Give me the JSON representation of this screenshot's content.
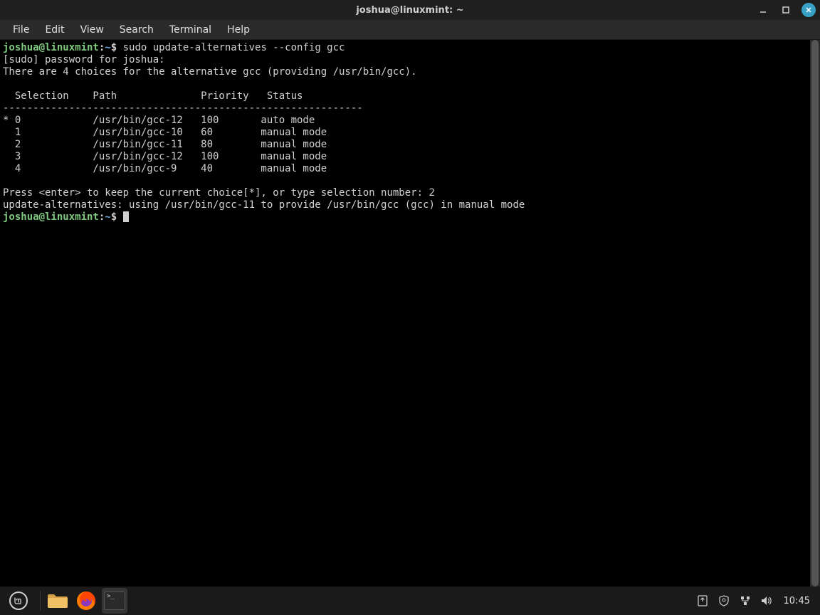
{
  "window": {
    "title": "joshua@linuxmint: ~"
  },
  "menubar": {
    "items": [
      "File",
      "Edit",
      "View",
      "Search",
      "Terminal",
      "Help"
    ]
  },
  "terminal": {
    "prompt_user": "joshua@linuxmint",
    "prompt_path": "~",
    "prompt_symbol": "$",
    "line1_cmd": "sudo update-alternatives --config gcc",
    "line2": "[sudo] password for joshua: ",
    "line3": "There are 4 choices for the alternative gcc (providing /usr/bin/gcc).",
    "blank": "",
    "header": "  Selection    Path              Priority   Status",
    "separator": "------------------------------------------------------------",
    "rows": [
      "* 0            /usr/bin/gcc-12   100       auto mode",
      "  1            /usr/bin/gcc-10   60        manual mode",
      "  2            /usr/bin/gcc-11   80        manual mode",
      "  3            /usr/bin/gcc-12   100       manual mode",
      "  4            /usr/bin/gcc-9    40        manual mode"
    ],
    "press_line": "Press <enter> to keep the current choice[*], or type selection number: 2",
    "result_line": "update-alternatives: using /usr/bin/gcc-11 to provide /usr/bin/gcc (gcc) in manual mode"
  },
  "taskbar": {
    "time": "10:45"
  }
}
